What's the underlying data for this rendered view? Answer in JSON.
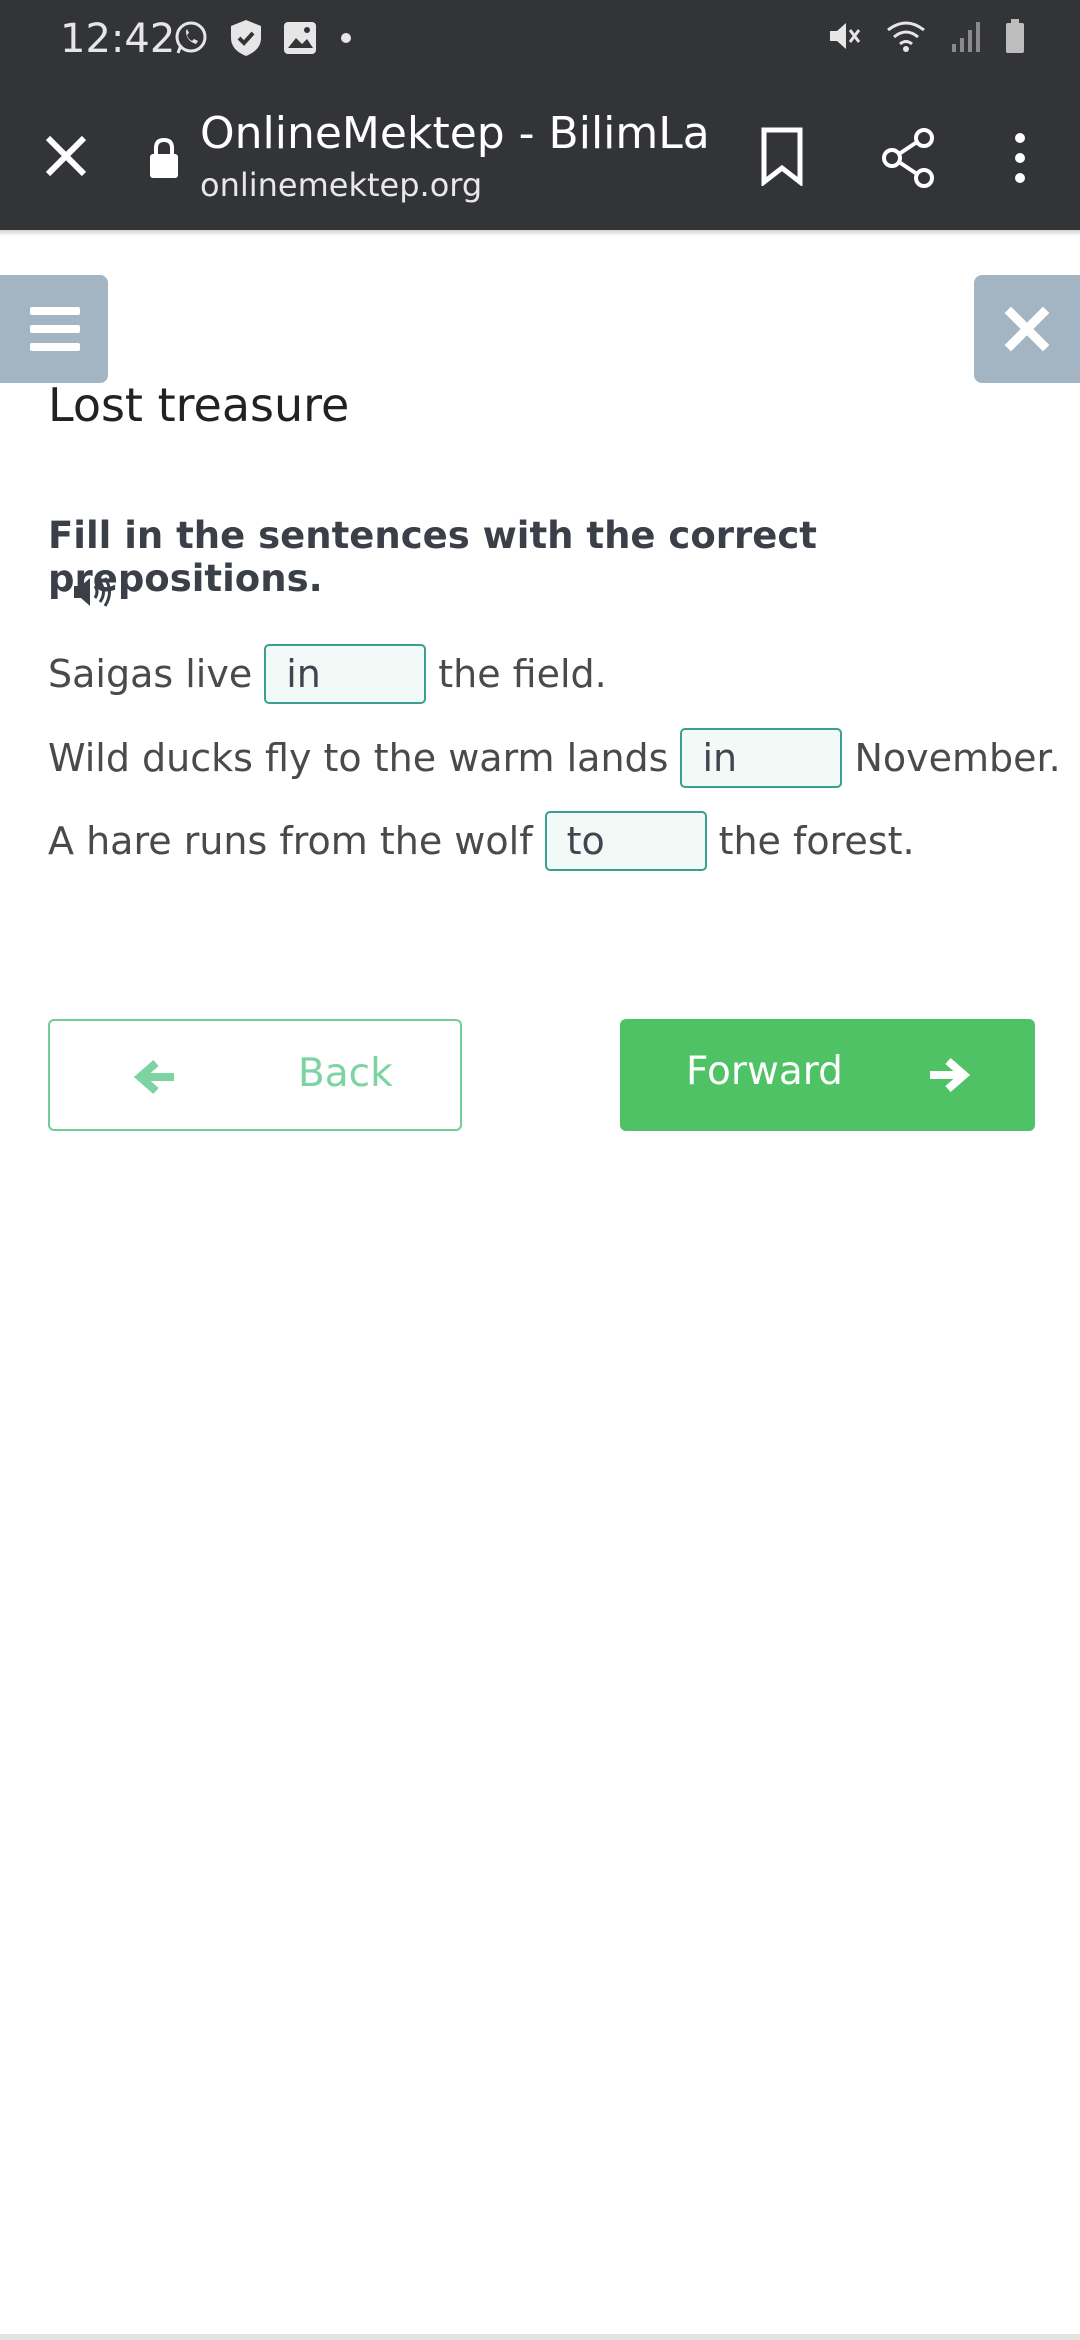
{
  "status_bar": {
    "time": "12:42",
    "left_icons": [
      "whatsapp-icon",
      "shield-icon",
      "image-icon",
      "dot-icon"
    ],
    "right_icons": [
      "mute-icon",
      "wifi-icon",
      "signal-icon",
      "battery-icon"
    ]
  },
  "browser": {
    "title": "OnlineMektep - BilimLa...",
    "url": "onlinemektep.org"
  },
  "page": {
    "title": "Lost treasure",
    "instruction": "Fill in the sentences with the correct prepositions."
  },
  "exercise": {
    "sentences": [
      {
        "before": "Saigas live",
        "answer": "in",
        "after": "the field."
      },
      {
        "before": "Wild ducks fly to the warm lands",
        "answer": "in",
        "after": "November."
      },
      {
        "before": "A hare runs from the wolf",
        "answer": "to",
        "after": "the forest."
      }
    ]
  },
  "navigation": {
    "back_label": "Back",
    "forward_label": "Forward"
  },
  "colors": {
    "status_bar_bg": "#323437",
    "side_button_bg": "#a3b5c3",
    "accent_green": "#50c266",
    "blank_border": "#3aa08d"
  }
}
